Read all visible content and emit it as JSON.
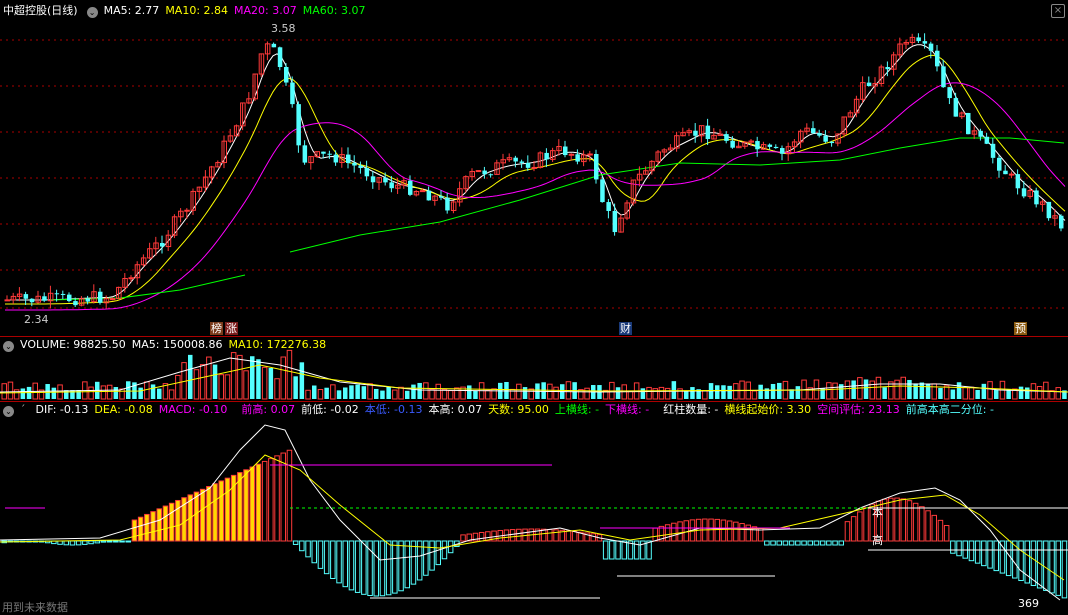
{
  "price_panel": {
    "title": "中超控股(日线)",
    "ma5_label": "MA5: 2.77",
    "ma10_label": "MA10: 2.84",
    "ma20_label": "MA20: 3.07",
    "ma60_label": "MA60: 3.07",
    "high_label": "3.58",
    "low_label": "2.34",
    "events": [
      "榜",
      "涨",
      "财",
      "预"
    ]
  },
  "volume_panel": {
    "volume_label": "VOLUME: 98825.50",
    "ma5_label": "MA5: 150008.86",
    "ma10_label": "MA10: 172276.38"
  },
  "macd_panel": {
    "dif": "DIF: -0.13",
    "dea": "DEA: -0.08",
    "macd": "MACD: -0.10",
    "prev_high": "前高: 0.07",
    "prev_low": "前低: -0.02",
    "this_low": "本低: -0.13",
    "this_high": "本高: 0.07",
    "days": "天数: 95.00",
    "upper_line": "上横线: -",
    "lower_line": "下横线: -",
    "red_count": "红柱数量: -",
    "start_price": "横线起始价: 3.30",
    "space_eval": "空间评估: 23.13",
    "quantile": "前高本高二分位: -",
    "mark_ben": "本",
    "mark_gao": "高",
    "corner_value": "369"
  },
  "footer": {
    "watermark": "用到未来数据"
  },
  "colors": {
    "background": "#000000",
    "up": "#ff3a3a",
    "down": "#54ffff",
    "ma5": "#ffffff",
    "ma10": "#ffff00",
    "ma20": "#ff00ff",
    "ma60": "#00ff00",
    "grid": "#aa0000"
  }
}
